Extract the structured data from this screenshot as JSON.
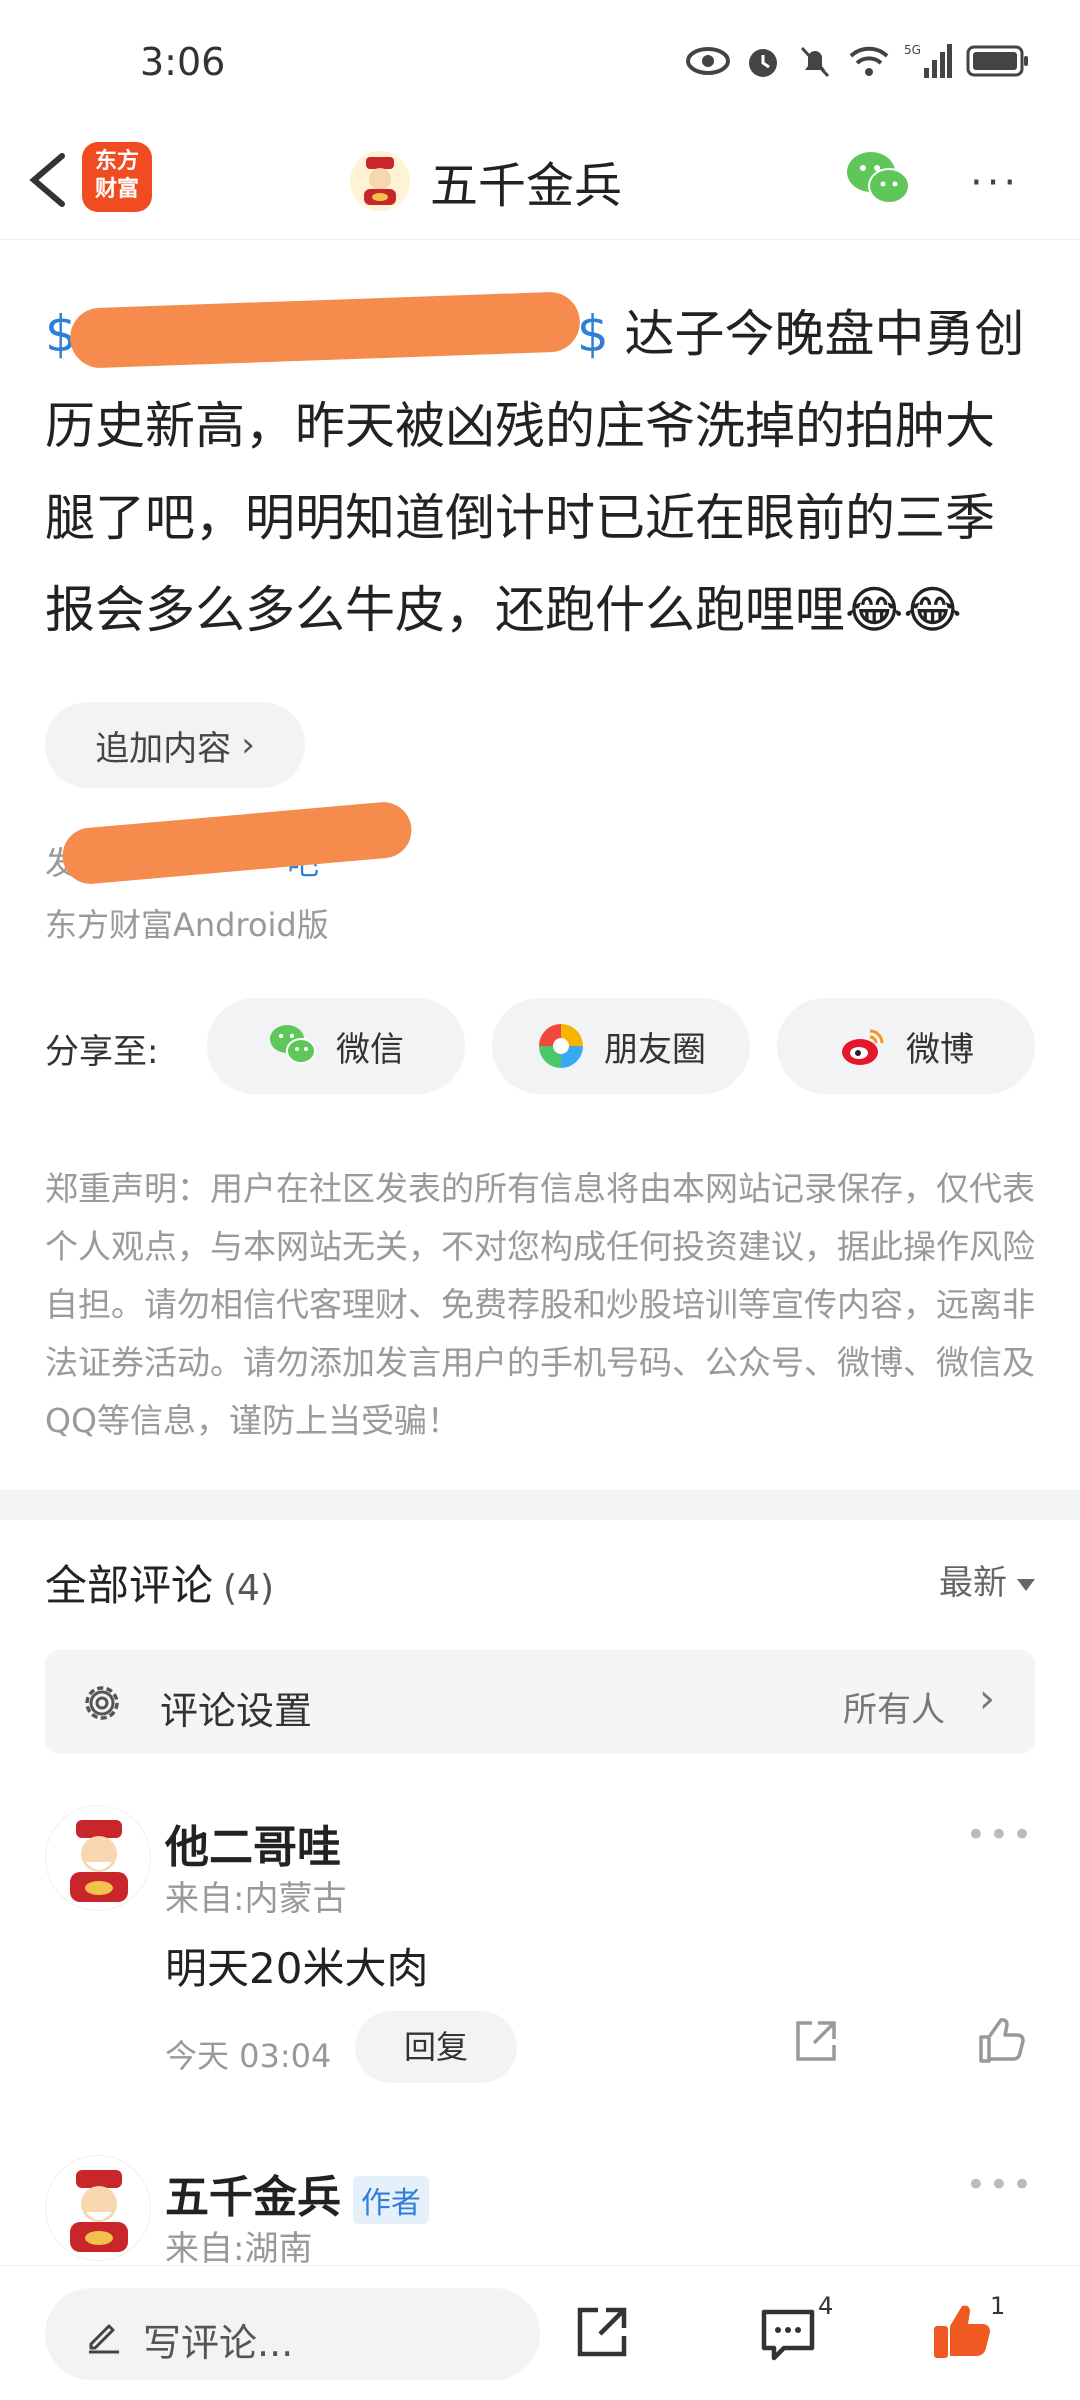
{
  "status": {
    "time": "3:06",
    "network": "5G"
  },
  "header": {
    "logo_line1": "东方",
    "logo_line2": "财富",
    "title": "五千金兵",
    "more": "···"
  },
  "post": {
    "link_prefix": "$",
    "link_suffix": "$",
    "text": " 达子今晚盘中勇创历史新高，昨天被凶残的庄爷洗掉的拍肿大腿了吧，明明知道倒计时已近在眼前的三季报会多么多么牛皮，还跑什么跑哩哩😂😂",
    "append_label": "追加内容",
    "publisher_prefix": "发",
    "publisher_link": "吧",
    "source": "东方财富Android版"
  },
  "share": {
    "label": "分享至:",
    "wechat": "微信",
    "moments": "朋友圈",
    "weibo": "微博"
  },
  "disclaimer": "郑重声明：用户在社区发表的所有信息将由本网站记录保存，仅代表个人观点，与本网站无关，不对您构成任何投资建议，据此操作风险自担。请勿相信代客理财、免费荐股和炒股培训等宣传内容，远离非法证券活动。请勿添加发言用户的手机号码、公众号、微博、微信及QQ等信息，谨防上当受骗！",
  "comments": {
    "title": "全部评论",
    "count": "(4)",
    "sort": "最新",
    "settings_label": "评论设置",
    "settings_value": "所有人",
    "items": [
      {
        "name": "他二哥哇",
        "location": "来自:内蒙古",
        "text": "明天20米大肉",
        "time": "今天 03:04",
        "reply": "回复"
      },
      {
        "name": "五千金兵",
        "badge": "作者",
        "location": "来自:湖南"
      }
    ]
  },
  "bottom": {
    "input_placeholder": "写评论...",
    "comment_count": "4",
    "like_count": "1"
  },
  "colors": {
    "link": "#2f7fd6",
    "brand": "#f04b21",
    "like": "#f05a22",
    "redaction": "#f58b4d"
  }
}
